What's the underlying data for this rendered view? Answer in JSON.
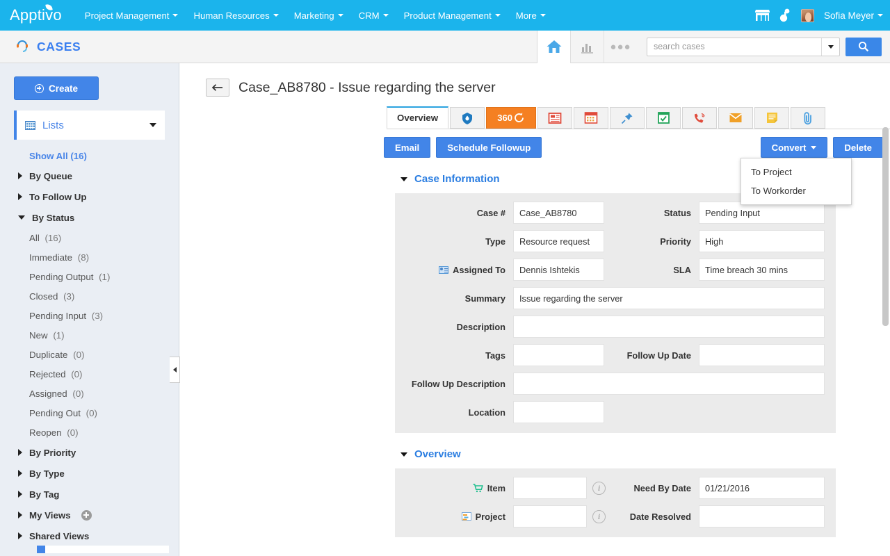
{
  "topnav": {
    "brand": "Apptivo",
    "items": [
      {
        "label": "Project Management"
      },
      {
        "label": "Human Resources"
      },
      {
        "label": "Marketing"
      },
      {
        "label": "CRM"
      },
      {
        "label": "Product Management"
      },
      {
        "label": "More"
      }
    ],
    "user": "Sofia Meyer",
    "icons": [
      "store-icon",
      "connections-icon"
    ],
    "accent": "#1bb4ec"
  },
  "appheader": {
    "title": "CASES",
    "home_icon": "home-icon",
    "report_icon": "bar-chart-icon",
    "more_icon": "ellipsis-icon",
    "search": {
      "placeholder": "search cases",
      "value": ""
    },
    "search_button_icon": "magnifier-icon",
    "accent": "#3a7ff0"
  },
  "sidebar": {
    "create_label": "Create",
    "lists_label": "Lists",
    "show_all_label": "Show All (16)",
    "nodes": [
      {
        "label": "By Queue",
        "expanded": false
      },
      {
        "label": "To Follow Up",
        "expanded": false
      },
      {
        "label": "By Status",
        "expanded": true
      }
    ],
    "status_items": [
      {
        "label": "All",
        "count": "(16)"
      },
      {
        "label": "Immediate",
        "count": "(8)"
      },
      {
        "label": "Pending Output",
        "count": "(1)"
      },
      {
        "label": "Closed",
        "count": "(3)"
      },
      {
        "label": "Pending Input",
        "count": "(3)"
      },
      {
        "label": "New",
        "count": "(1)"
      },
      {
        "label": "Duplicate",
        "count": "(0)"
      },
      {
        "label": "Rejected",
        "count": "(0)"
      },
      {
        "label": "Assigned",
        "count": "(0)"
      },
      {
        "label": "Pending Out",
        "count": "(0)"
      },
      {
        "label": "Reopen",
        "count": "(0)"
      }
    ],
    "bottom_nodes": [
      {
        "label": "By Priority"
      },
      {
        "label": "By Type"
      },
      {
        "label": "By Tag"
      },
      {
        "label": "My Views",
        "has_add": true
      },
      {
        "label": "Shared Views"
      }
    ]
  },
  "main": {
    "back_icon": "back-arrow-icon",
    "case_title": "Case_AB8780 - Issue regarding the server",
    "tabs": [
      {
        "label": "Overview",
        "type": "text",
        "active": true
      },
      {
        "label": "",
        "icon": "drop-shield-icon",
        "type": "icon"
      },
      {
        "label": "360",
        "icon": "refresh-360-icon",
        "type": "360"
      },
      {
        "label": "",
        "icon": "news-list-icon",
        "type": "icon"
      },
      {
        "label": "",
        "icon": "calendar-icon",
        "type": "icon"
      },
      {
        "label": "",
        "icon": "pin-icon",
        "type": "icon"
      },
      {
        "label": "",
        "icon": "task-check-icon",
        "type": "icon"
      },
      {
        "label": "",
        "icon": "phone-call-icon",
        "type": "icon"
      },
      {
        "label": "",
        "icon": "envelope-icon",
        "type": "icon"
      },
      {
        "label": "",
        "icon": "note-icon",
        "type": "icon"
      },
      {
        "label": "",
        "icon": "paperclip-icon",
        "type": "icon"
      }
    ],
    "actions": {
      "email": "Email",
      "schedule_followup": "Schedule Followup",
      "convert": "Convert",
      "delete": "Delete",
      "convert_menu": [
        {
          "label": "To Project"
        },
        {
          "label": "To Workorder"
        }
      ]
    },
    "case_information": {
      "section_title": "Case Information",
      "case_number_label": "Case #",
      "case_number_value": "Case_AB8780",
      "status_label": "Status",
      "status_value": "Pending Input",
      "type_label": "Type",
      "type_value": "Resource request",
      "priority_label": "Priority",
      "priority_value": "High",
      "assigned_to_label": "Assigned To",
      "assigned_to_value": "Dennis Ishtekis",
      "sla_label": "SLA",
      "sla_value": "Time breach 30 mins",
      "summary_label": "Summary",
      "summary_value": "Issue regarding the server",
      "description_label": "Description",
      "description_value": "",
      "tags_label": "Tags",
      "tags_value": "",
      "follow_up_date_label": "Follow Up Date",
      "follow_up_date_value": "",
      "follow_up_description_label": "Follow Up Description",
      "follow_up_description_value": "",
      "location_label": "Location",
      "location_value": ""
    },
    "overview": {
      "section_title": "Overview",
      "item_label": "Item",
      "item_value": "",
      "need_by_date_label": "Need By Date",
      "need_by_date_value": "01/21/2016",
      "project_label": "Project",
      "project_value": "",
      "date_resolved_label": "Date Resolved",
      "date_resolved_value": ""
    }
  }
}
